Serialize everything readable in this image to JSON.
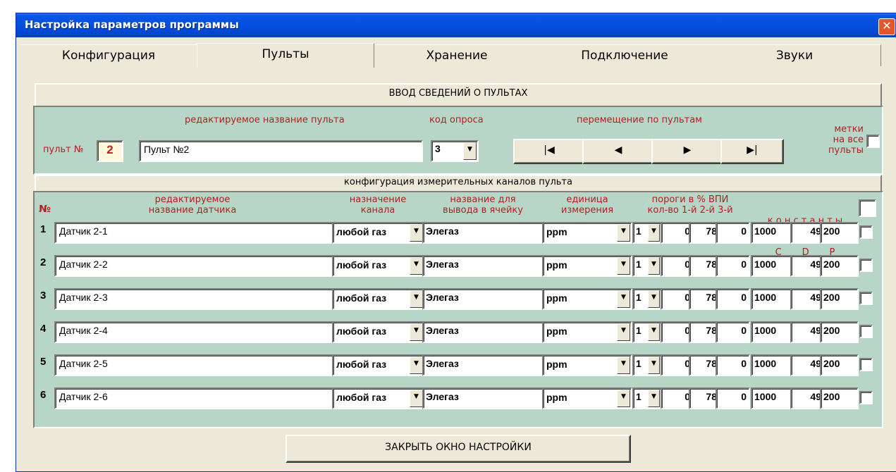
{
  "window": {
    "title": "Настройка параметров программы",
    "close": "✕"
  },
  "tabs": [
    "Конфигурация",
    "Пульты",
    "Хранение",
    "Подключение",
    "Звуки"
  ],
  "section_title": "ВВОД СВЕДЕНИЙ О ПУЛЬТАХ",
  "console": {
    "num_label": "пульт №",
    "num_value": "2",
    "name_label": "редактируемое название пульта",
    "name_value": "Пульт №2",
    "poll_label": "код опроса",
    "poll_value": "3",
    "nav_label": "перемещение по пультам",
    "nav_buttons": [
      "|◀",
      "◀",
      "▶",
      "▶|"
    ],
    "marks_label": [
      "метки",
      "на все",
      "пульты"
    ]
  },
  "channels_title": "конфигурация измерительных каналов пульта",
  "columns": {
    "num": "№",
    "name": [
      "редактируемое",
      "название датчика"
    ],
    "purpose": [
      "назначение",
      "канала"
    ],
    "display": [
      "название для",
      "вывода в ячейку"
    ],
    "unit": [
      "единица",
      "измерения"
    ],
    "thresholds": [
      "пороги  в % ВПИ",
      "кол-во  1-й  2-й  3-й"
    ],
    "constants": [
      "к о н с т а н т ы",
      "C       D       P"
    ]
  },
  "rows": [
    {
      "n": "1",
      "name": "Датчик 2-1",
      "purpose": "любой газ",
      "display": "Элегаз",
      "unit": "ppm",
      "count": "1",
      "t1": "0",
      "t2": "78",
      "t3": "0",
      "c": "1000",
      "d": "49",
      "p": "200"
    },
    {
      "n": "2",
      "name": "Датчик 2-2",
      "purpose": "любой газ",
      "display": "Элегаз",
      "unit": "ppm",
      "count": "1",
      "t1": "0",
      "t2": "78",
      "t3": "0",
      "c": "1000",
      "d": "49",
      "p": "200"
    },
    {
      "n": "3",
      "name": "Датчик 2-3",
      "purpose": "любой газ",
      "display": "Элегаз",
      "unit": "ppm",
      "count": "1",
      "t1": "0",
      "t2": "78",
      "t3": "0",
      "c": "1000",
      "d": "49",
      "p": "200"
    },
    {
      "n": "4",
      "name": "Датчик 2-4",
      "purpose": "любой газ",
      "display": "Элегаз",
      "unit": "ppm",
      "count": "1",
      "t1": "0",
      "t2": "78",
      "t3": "0",
      "c": "1000",
      "d": "49",
      "p": "200"
    },
    {
      "n": "5",
      "name": "Датчик 2-5",
      "purpose": "любой газ",
      "display": "Элегаз",
      "unit": "ppm",
      "count": "1",
      "t1": "0",
      "t2": "78",
      "t3": "0",
      "c": "1000",
      "d": "49",
      "p": "200"
    },
    {
      "n": "6",
      "name": "Датчик 2-6",
      "purpose": "любой газ",
      "display": "Элегаз",
      "unit": "ppm",
      "count": "1",
      "t1": "0",
      "t2": "78",
      "t3": "0",
      "c": "1000",
      "d": "49",
      "p": "200"
    }
  ],
  "close_button": "ЗАКРЫТЬ ОКНО НАСТРОЙКИ"
}
